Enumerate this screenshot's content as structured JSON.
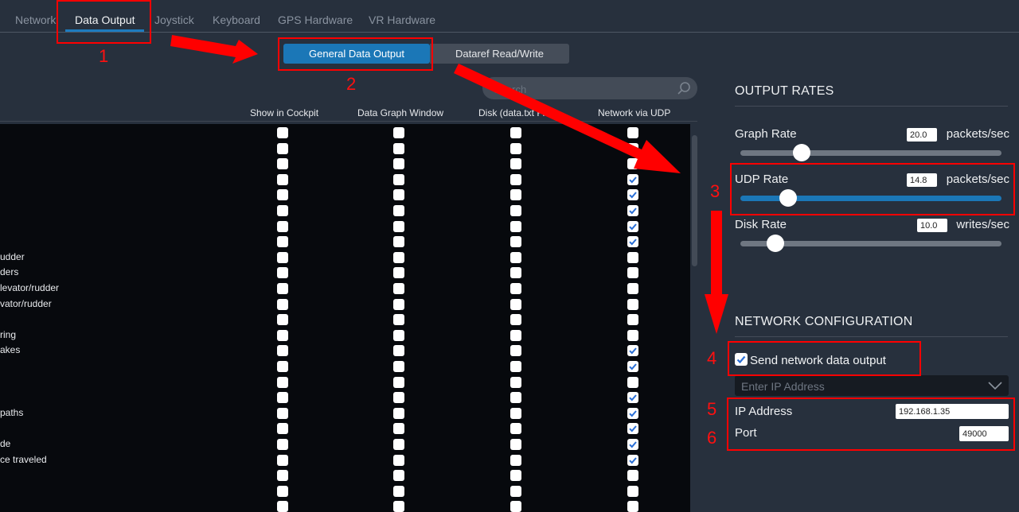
{
  "tabs": [
    {
      "label": "Network",
      "active": false
    },
    {
      "label": "Data Output",
      "active": true
    },
    {
      "label": "Joystick",
      "active": false
    },
    {
      "label": "Keyboard",
      "active": false
    },
    {
      "label": "GPS Hardware",
      "active": false
    },
    {
      "label": "VR Hardware",
      "active": false
    }
  ],
  "subtabs": {
    "general": "General Data Output",
    "dataref": "Dataref Read/Write"
  },
  "search": {
    "placeholder": "Search"
  },
  "columns": [
    "Show in Cockpit",
    "Data Graph Window",
    "Disk (data.txt File)",
    "Network via UDP"
  ],
  "rows": [
    {
      "label": "",
      "udp": false
    },
    {
      "label": "",
      "udp": false
    },
    {
      "label": "",
      "udp": false
    },
    {
      "label": "",
      "udp": true
    },
    {
      "label": "",
      "udp": true
    },
    {
      "label": "",
      "udp": true
    },
    {
      "label": "",
      "udp": true
    },
    {
      "label": "",
      "udp": true
    },
    {
      "label": "udder",
      "udp": false
    },
    {
      "label": "ders",
      "udp": false
    },
    {
      "label": "levator/rudder",
      "udp": false
    },
    {
      "label": "vator/rudder",
      "udp": false
    },
    {
      "label": "",
      "udp": false
    },
    {
      "label": "ring",
      "udp": false
    },
    {
      "label": "akes",
      "udp": true
    },
    {
      "label": "",
      "udp": true
    },
    {
      "label": "",
      "udp": false
    },
    {
      "label": "",
      "udp": true
    },
    {
      "label": "paths",
      "udp": true
    },
    {
      "label": "",
      "udp": true
    },
    {
      "label": "de",
      "udp": true
    },
    {
      "label": "ce traveled",
      "udp": true
    },
    {
      "label": "",
      "udp": false
    },
    {
      "label": "",
      "udp": false
    },
    {
      "label": "",
      "udp": false
    }
  ],
  "output_rates": {
    "title": "OUTPUT RATES",
    "graph": {
      "label": "Graph Rate",
      "value": "20.0",
      "unit": "packets/sec",
      "slider_fraction": 0.2
    },
    "udp": {
      "label": "UDP Rate",
      "value": "14.8",
      "unit": "packets/sec",
      "slider_fraction": 0.15
    },
    "disk": {
      "label": "Disk Rate",
      "value": "10.0",
      "unit": "writes/sec",
      "slider_fraction": 0.1
    }
  },
  "network_config": {
    "title": "NETWORK CONFIGURATION",
    "send_label": "Send network data output",
    "send_checked": true,
    "ip_dropdown_placeholder": "Enter IP Address",
    "ip_label": "IP Address",
    "ip_value": "192.168.1.35",
    "port_label": "Port",
    "port_value": "49000"
  },
  "annotations": [
    "1",
    "2",
    "3",
    "4",
    "5",
    "6"
  ],
  "colors": {
    "accent": "#1b77b7",
    "annotation": "#ff0000",
    "check": "#2a6fd6"
  }
}
